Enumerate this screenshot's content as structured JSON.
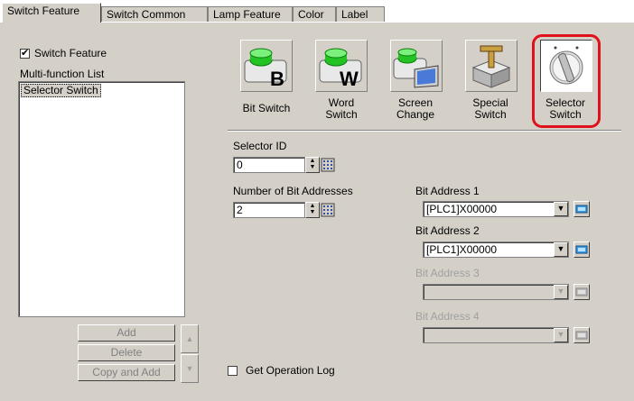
{
  "tabs": [
    "Switch Feature",
    "Switch Common",
    "Lamp Feature",
    "Color",
    "Label"
  ],
  "left": {
    "switch_feature_checkbox": "Switch Feature",
    "switch_feature_checked": "✔",
    "list_label": "Multi-function List",
    "list_items": [
      "Selector Switch"
    ],
    "add_button": "Add",
    "delete_button": "Delete",
    "copy_add_button": "Copy and Add"
  },
  "icons": [
    {
      "label": "Bit Switch",
      "icon": "bit-switch-icon"
    },
    {
      "label": "Word\nSwitch",
      "icon": "word-switch-icon"
    },
    {
      "label": "Screen\nChange",
      "icon": "screen-change-icon"
    },
    {
      "label": "Special\nSwitch",
      "icon": "special-switch-icon"
    },
    {
      "label": "Selector\nSwitch",
      "icon": "selector-switch-icon"
    }
  ],
  "icon_letters": {
    "bit": "B",
    "word": "W"
  },
  "form": {
    "selector_id_label": "Selector ID",
    "selector_id_value": "0",
    "num_bit_label": "Number of Bit Addresses",
    "num_bit_value": "2",
    "bit_address_1_label": "Bit Address 1",
    "bit_address_1_value": "[PLC1]X00000",
    "bit_address_2_label": "Bit Address 2",
    "bit_address_2_value": "[PLC1]X00000",
    "bit_address_3_label": "Bit Address 3",
    "bit_address_3_value": "",
    "bit_address_4_label": "Bit Address 4",
    "bit_address_4_value": "",
    "get_operation_log": "Get Operation Log"
  },
  "colors": {
    "highlight": "#e0101c",
    "panel": "#d4d0c8",
    "green": "#22c322"
  }
}
